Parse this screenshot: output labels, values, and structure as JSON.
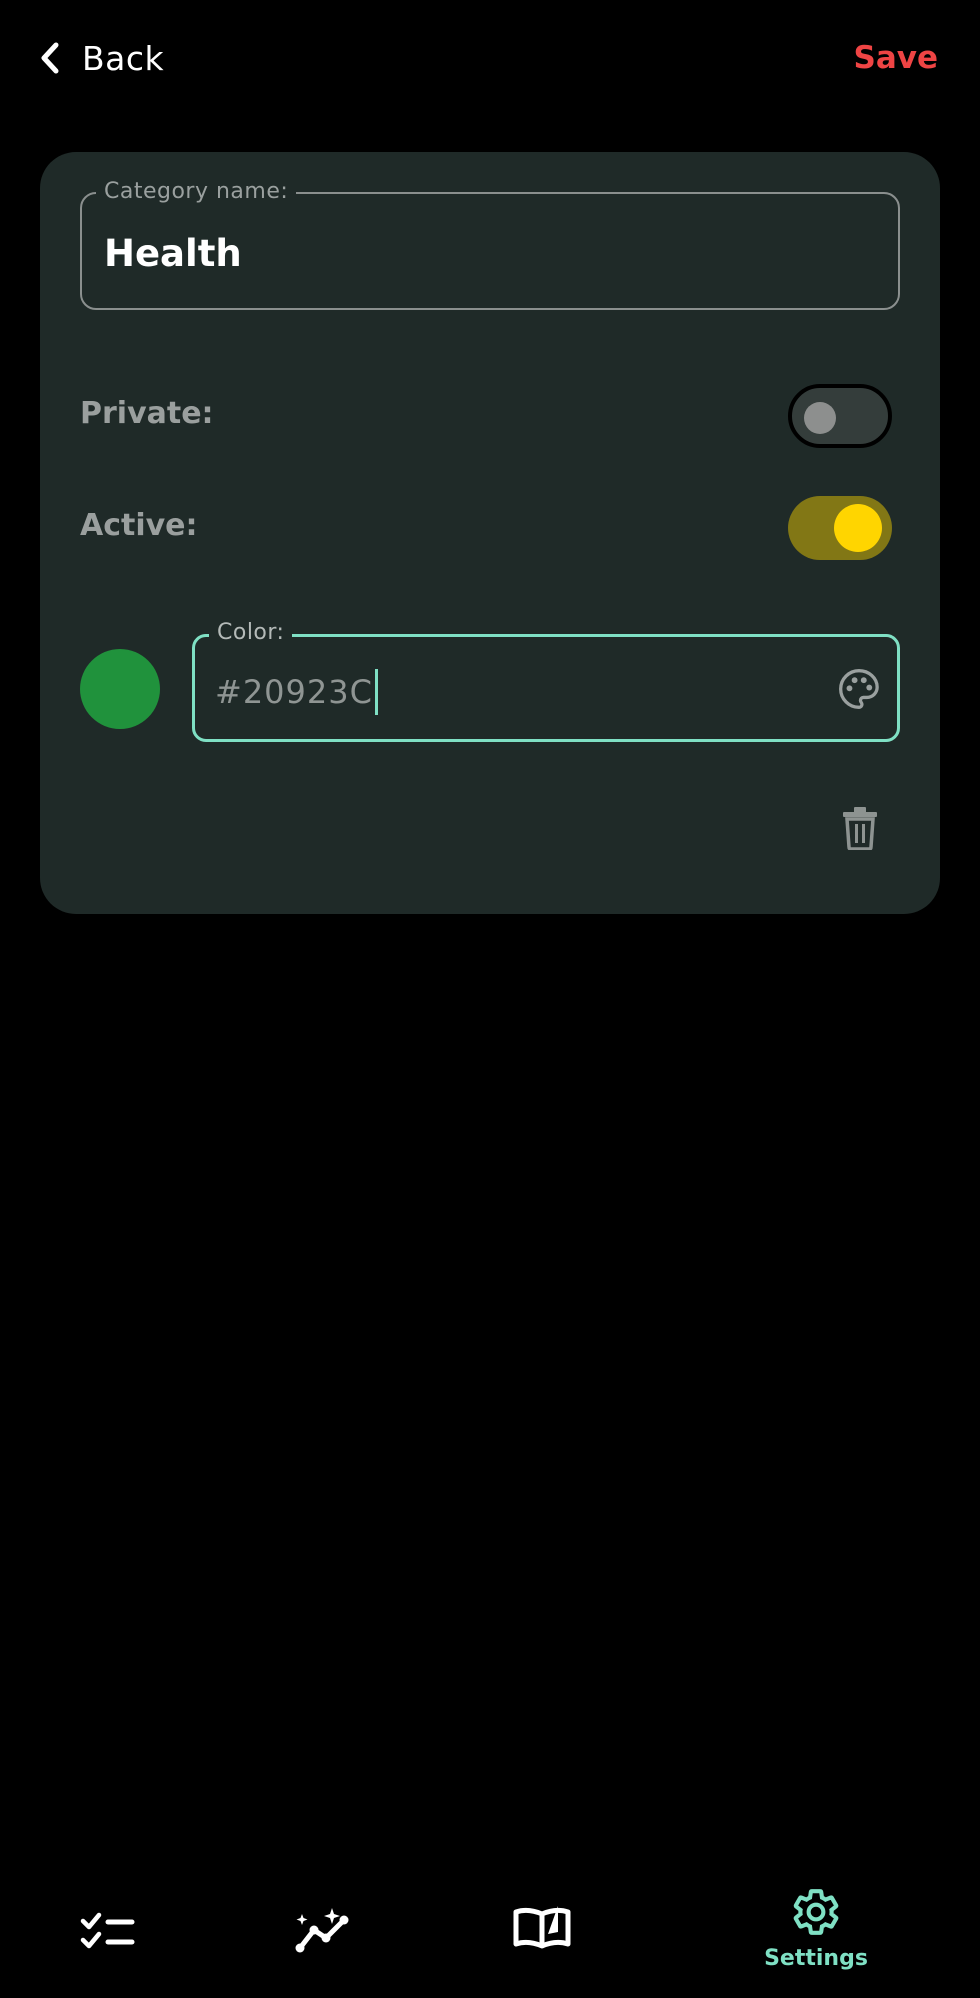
{
  "header": {
    "back_label": "Back",
    "save_label": "Save"
  },
  "form": {
    "name_legend": "Category name:",
    "name_value": "Health",
    "private_label": "Private:",
    "private_on": false,
    "active_label": "Active:",
    "active_on": true,
    "color_legend": "Color:",
    "color_value": "#20923C",
    "swatch_color": "#20923C"
  },
  "nav": {
    "items": [
      {
        "icon": "checklist-icon",
        "label": ""
      },
      {
        "icon": "trend-sparkle-icon",
        "label": ""
      },
      {
        "icon": "open-book-icon",
        "label": ""
      },
      {
        "icon": "gear-icon",
        "label": "Settings",
        "active": true
      }
    ]
  },
  "colors": {
    "accent": "#7FE0C4",
    "save": "#EF4444",
    "toggle_on": "#FFD500",
    "card": "#1F2A28"
  }
}
